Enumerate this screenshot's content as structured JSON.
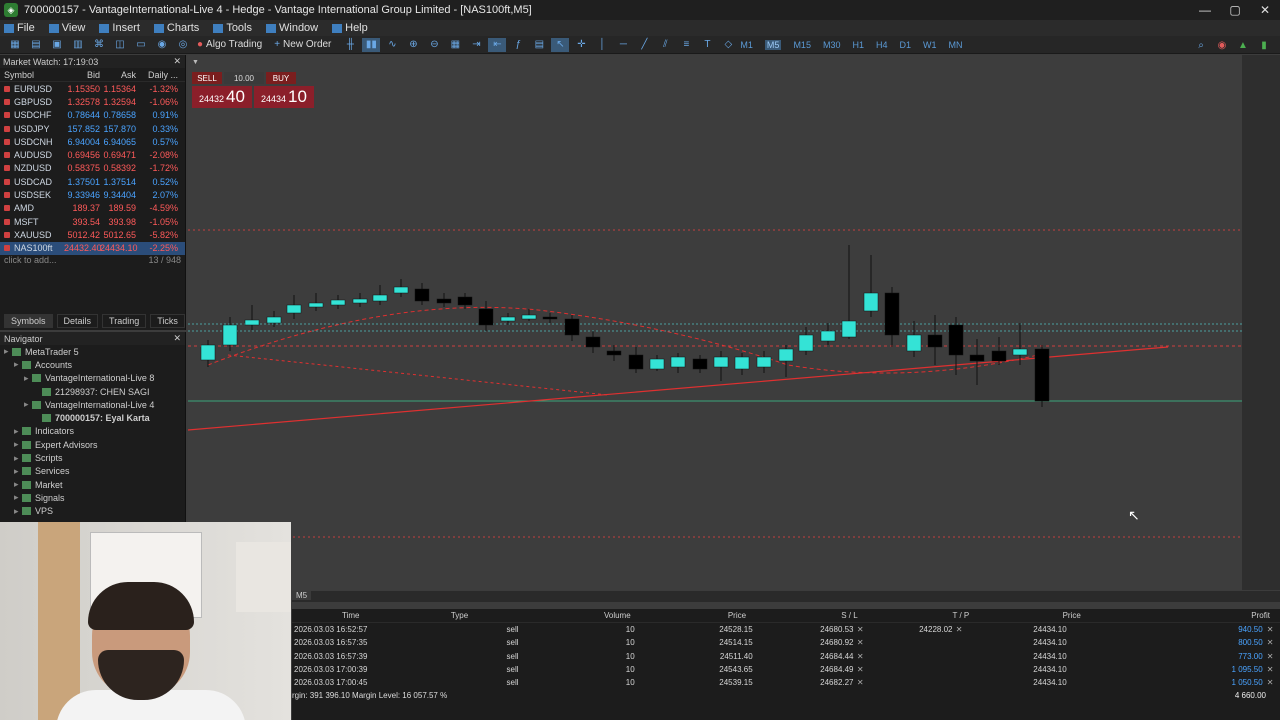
{
  "window": {
    "title": "700000157 - VantageInternational-Live 4 - Hedge - Vantage International Group Limited - [NAS100ft,M5]",
    "minimize_icon": "minimize-icon",
    "maximize_icon": "maximize-icon",
    "close_icon": "close-icon"
  },
  "menu": [
    "File",
    "View",
    "Insert",
    "Charts",
    "Tools",
    "Window",
    "Help"
  ],
  "toolbar": {
    "algo_trading": "Algo Trading",
    "new_order": "New Order",
    "timeframes": [
      "M1",
      "M5",
      "M15",
      "M30",
      "H1",
      "H4",
      "D1",
      "W1",
      "MN"
    ],
    "active_timeframe": "M5"
  },
  "market_watch": {
    "title": "Market Watch: 17:19:03",
    "columns": [
      "Symbol",
      "Bid",
      "Ask",
      "Daily ..."
    ],
    "rows": [
      {
        "symbol": "EURUSD",
        "bid": "1.15350",
        "ask": "1.15364",
        "change": "-1.32%",
        "dir": "down"
      },
      {
        "symbol": "GBPUSD",
        "bid": "1.32578",
        "ask": "1.32594",
        "change": "-1.06%",
        "dir": "down"
      },
      {
        "symbol": "USDCHF",
        "bid": "0.78644",
        "ask": "0.78658",
        "change": "0.91%",
        "dir": "up"
      },
      {
        "symbol": "USDJPY",
        "bid": "157.852",
        "ask": "157.870",
        "change": "0.33%",
        "dir": "up"
      },
      {
        "symbol": "USDCNH",
        "bid": "6.94004",
        "ask": "6.94065",
        "change": "0.57%",
        "dir": "up"
      },
      {
        "symbol": "AUDUSD",
        "bid": "0.69456",
        "ask": "0.69471",
        "change": "-2.08%",
        "dir": "down"
      },
      {
        "symbol": "NZDUSD",
        "bid": "0.58375",
        "ask": "0.58392",
        "change": "-1.72%",
        "dir": "down"
      },
      {
        "symbol": "USDCAD",
        "bid": "1.37501",
        "ask": "1.37514",
        "change": "0.52%",
        "dir": "up"
      },
      {
        "symbol": "USDSEK",
        "bid": "9.33946",
        "ask": "9.34404",
        "change": "2.07%",
        "dir": "up"
      },
      {
        "symbol": "AMD",
        "bid": "189.37",
        "ask": "189.59",
        "change": "-4.59%",
        "dir": "down"
      },
      {
        "symbol": "MSFT",
        "bid": "393.54",
        "ask": "393.98",
        "change": "-1.05%",
        "dir": "down"
      },
      {
        "symbol": "XAUUSD",
        "bid": "5012.42",
        "ask": "5012.65",
        "change": "-5.82%",
        "dir": "down"
      },
      {
        "symbol": "NAS100ft",
        "bid": "24432.40",
        "ask": "24434.10",
        "change": "-2.25%",
        "dir": "down",
        "selected": true
      }
    ],
    "add_placeholder": "click to add...",
    "count": "13 / 948",
    "tabs": [
      "Symbols",
      "Details",
      "Trading",
      "Ticks"
    ]
  },
  "navigator": {
    "title": "Navigator",
    "items": [
      {
        "label": "MetaTrader 5",
        "indent": 0
      },
      {
        "label": "Accounts",
        "indent": 1
      },
      {
        "label": "VantageInternational-Live 8",
        "indent": 2
      },
      {
        "label": "21298937: CHEN SAGI",
        "indent": 3
      },
      {
        "label": "VantageInternational-Live 4",
        "indent": 2
      },
      {
        "label": "700000157: Eyal Karta",
        "indent": 3,
        "bold": true
      },
      {
        "label": "Indicators",
        "indent": 1
      },
      {
        "label": "Expert Advisors",
        "indent": 1
      },
      {
        "label": "Scripts",
        "indent": 1
      },
      {
        "label": "Services",
        "indent": 1
      },
      {
        "label": "Market",
        "indent": 1
      },
      {
        "label": "Signals",
        "indent": 1
      },
      {
        "label": "VPS",
        "indent": 1
      }
    ]
  },
  "trade_panel": {
    "sell": "SELL",
    "buy": "BUY",
    "volume": "10.00",
    "bid_main": "24432",
    "bid_big": "40",
    "ask_main": "24434",
    "ask_big": "10"
  },
  "chart": {
    "timeframe_tab": "M5",
    "colors": {
      "bull": "#34e3d6",
      "bear": "#000000",
      "line": "#e03030"
    }
  },
  "trades": {
    "columns": [
      "Time",
      "Type",
      "Volume",
      "Price",
      "S / L",
      "T / P",
      "Price",
      "Profit"
    ],
    "rows": [
      {
        "time": "2026.03.03 16:52:57",
        "type": "sell",
        "volume": "10",
        "price": "24528.15",
        "sl": "24680.53",
        "tp": "24228.02",
        "current": "24434.10",
        "profit": "940.50"
      },
      {
        "time": "2026.03.03 16:57:35",
        "type": "sell",
        "volume": "10",
        "price": "24514.15",
        "sl": "24680.92",
        "tp": "",
        "current": "24434.10",
        "profit": "800.50"
      },
      {
        "time": "2026.03.03 16:57:39",
        "type": "sell",
        "volume": "10",
        "price": "24511.40",
        "sl": "24684.44",
        "tp": "",
        "current": "24434.10",
        "profit": "773.00"
      },
      {
        "time": "2026.03.03 17:00:39",
        "type": "sell",
        "volume": "10",
        "price": "24543.65",
        "sl": "24684.49",
        "tp": "",
        "current": "24434.10",
        "profit": "1 095.50"
      },
      {
        "time": "2026.03.03 17:00:45",
        "type": "sell",
        "volume": "10",
        "price": "24539.15",
        "sl": "24682.27",
        "tp": "",
        "current": "24434.10",
        "profit": "1 050.50"
      }
    ],
    "summary": "rgin: 391 396.10  Margin Level: 16 057.57 %",
    "total_profit": "4 660.00"
  }
}
